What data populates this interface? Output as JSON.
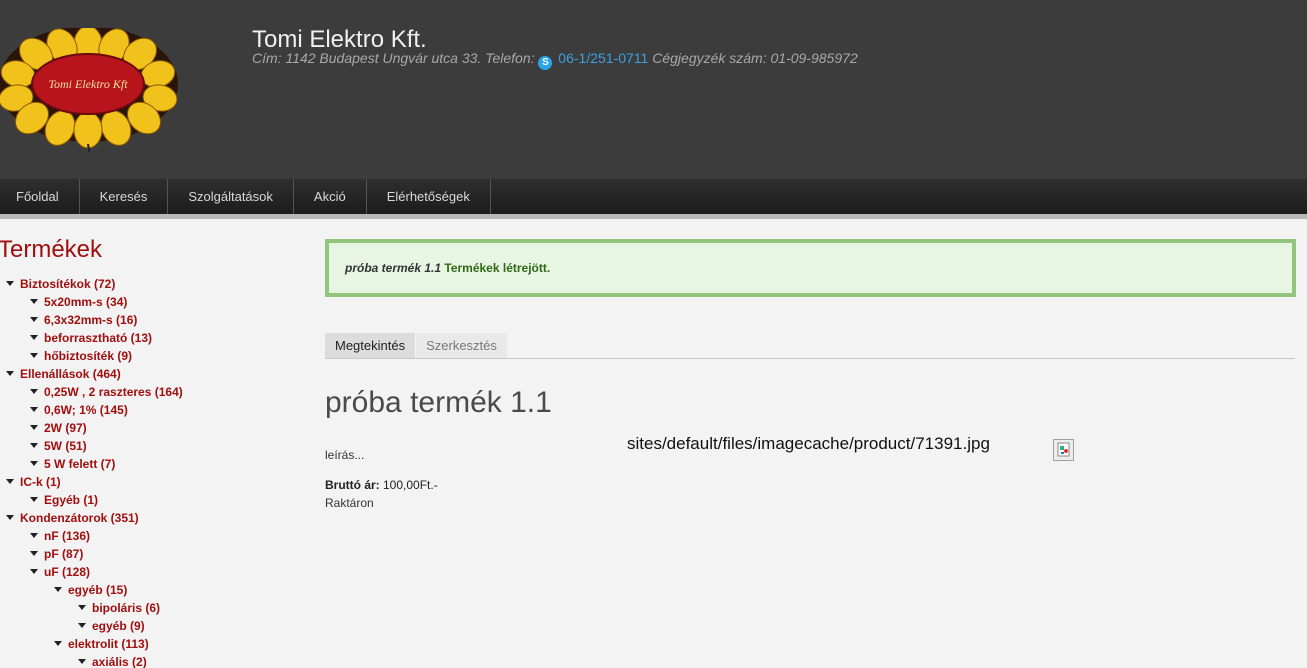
{
  "header": {
    "site_name": "Tomi Elektro Kft.",
    "logo_text": "Tomi Elektro Kft",
    "address_label": "Cím: 1142 Budapest Ungvár utca 33. Telefon: ",
    "phone": "06-1/251-0711",
    "registry": "Cégjegyzék szám: 01-09-985972"
  },
  "nav": [
    "Főoldal",
    "Keresés",
    "Szolgáltatások",
    "Akció",
    "Elérhetőségek"
  ],
  "sidebar": {
    "title": "Termékek",
    "tree": [
      {
        "label": "Biztosítékok (72)",
        "level": 0
      },
      {
        "label": "5x20mm-s (34)",
        "level": 1
      },
      {
        "label": "6,3x32mm-s (16)",
        "level": 1
      },
      {
        "label": "beforrasztható (13)",
        "level": 1
      },
      {
        "label": "hőbiztosíték (9)",
        "level": 1
      },
      {
        "label": "Ellenállások (464)",
        "level": 0
      },
      {
        "label": "0,25W , 2 raszteres (164)",
        "level": 1
      },
      {
        "label": "0,6W; 1% (145)",
        "level": 1
      },
      {
        "label": "2W (97)",
        "level": 1
      },
      {
        "label": "5W (51)",
        "level": 1
      },
      {
        "label": "5 W felett (7)",
        "level": 1
      },
      {
        "label": "IC-k (1)",
        "level": 0
      },
      {
        "label": "Egyéb (1)",
        "level": 1
      },
      {
        "label": "Kondenzátorok (351)",
        "level": 0
      },
      {
        "label": "nF (136)",
        "level": 1
      },
      {
        "label": "pF (87)",
        "level": 1
      },
      {
        "label": "uF (128)",
        "level": 1
      },
      {
        "label": "egyéb (15)",
        "level": 2
      },
      {
        "label": "bipoláris (6)",
        "level": 3
      },
      {
        "label": "egyéb (9)",
        "level": 3
      },
      {
        "label": "elektrolit (113)",
        "level": 2
      },
      {
        "label": "axiális (2)",
        "level": 3
      }
    ]
  },
  "message": {
    "product_name": "próba termék 1.1",
    "text": " Termékek létrejött."
  },
  "tabs": {
    "view": "Megtekintés",
    "edit": "Szerkesztés"
  },
  "node": {
    "title": "próba termék 1.1",
    "description": "leírás...",
    "price_label": "Bruttó ár:",
    "price_value": " 100,00Ft.-",
    "stock": "Raktáron",
    "image_path": "sites/default/files/imagecache/product/71391.jpg"
  }
}
